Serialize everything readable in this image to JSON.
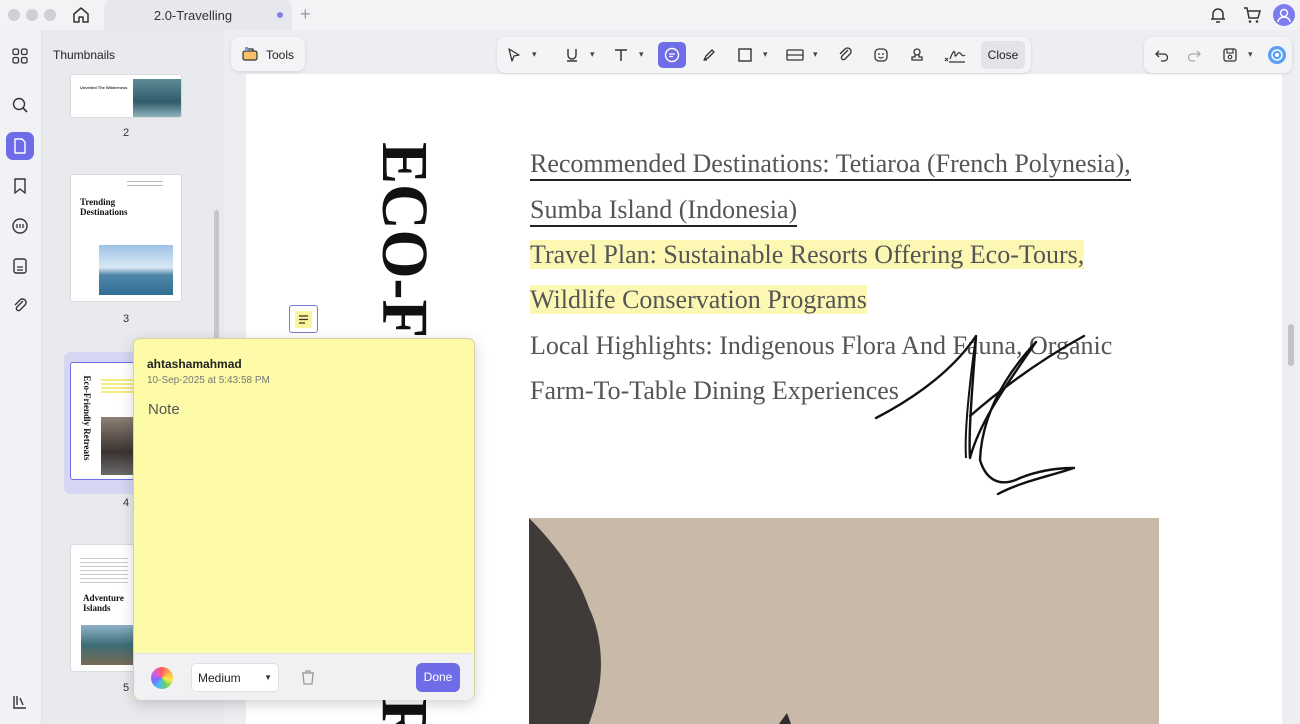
{
  "window": {
    "tab_title": "2.0-Travelling",
    "new_tab": "+"
  },
  "sidebar": {
    "title": "Thumbnails",
    "pages": [
      "2",
      "3",
      "4",
      "5"
    ]
  },
  "thumbnails": {
    "p2_heading": "Unveiled The Wilderness",
    "p3_title_line1": "Trending",
    "p3_title_line2": "Destinations",
    "p4_title": "Eco-Friendly Retreats",
    "p5_title_line1": "Adventure",
    "p5_title_line2": "Islands"
  },
  "toolbar": {
    "tools_label": "Tools",
    "close_label": "Close"
  },
  "document": {
    "vertical_title": "ECO-F",
    "vertical_title_bottom": "R",
    "lines": [
      "Recommended Destinations: Tetiaroa (French Polynesia),",
      "Sumba Island (Indonesia)",
      "Travel Plan: Sustainable Resorts Offering Eco-Tours,",
      "Wildlife Conservation Programs",
      "Local Highlights: Indigenous Flora And Fauna, Organic",
      "Farm-To-Table Dining Experiences"
    ]
  },
  "note": {
    "author": "ahtashamahmad",
    "timestamp": "10-Sep-2025 at 5:43:58 PM",
    "text": "Note",
    "size_selected": "Medium",
    "done_label": "Done"
  },
  "colors": {
    "accent": "#6e6de7",
    "note_bg": "#fdfba8",
    "highlight": "#fdf7b4"
  }
}
